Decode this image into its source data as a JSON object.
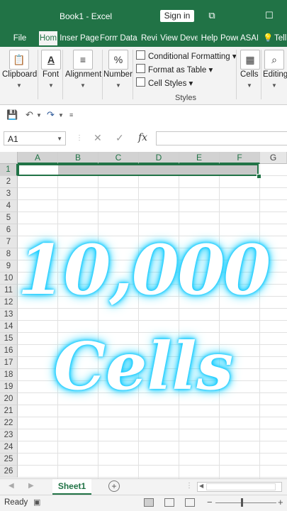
{
  "window": {
    "title": "Book1  -  Excel",
    "signin_label": "Sign in",
    "restore_icon": "⧉",
    "maximize_icon": "☐"
  },
  "tabs": [
    "File",
    "Hom",
    "Inser",
    "Page",
    "Form",
    "Data",
    "Revi",
    "View",
    "Deve",
    "Help",
    "Powe",
    "ASAI",
    "Tell"
  ],
  "tell_icon": "💡",
  "ribbon": {
    "clipboard": "Clipboard",
    "font": "Font",
    "alignment": "Alignment",
    "number": "Number",
    "conditional_formatting": "Conditional Formatting",
    "format_as_table": "Format as Table",
    "cell_styles": "Cell Styles",
    "styles_group": "Styles",
    "cells": "Cells",
    "editing": "Editing"
  },
  "formula_bar": {
    "name_box": "A1",
    "fx": "fx",
    "formula": ""
  },
  "columns": [
    "A",
    "B",
    "C",
    "D",
    "E",
    "F",
    "G"
  ],
  "rows": [
    "1",
    "2",
    "3",
    "4",
    "5",
    "6",
    "7",
    "8",
    "9",
    "10",
    "11",
    "12",
    "13",
    "14",
    "15",
    "16",
    "17",
    "18",
    "19",
    "20",
    "21",
    "22",
    "23",
    "24",
    "25",
    "26"
  ],
  "overlay": {
    "line1": "10,000",
    "line2": "Cells"
  },
  "sheet": {
    "tab": "Sheet1",
    "add_icon": "+"
  },
  "status": {
    "text": "Ready",
    "zoom_minus": "−",
    "zoom_plus": "+"
  },
  "colors": {
    "accent": "#217346",
    "glow": "#14c9ff"
  }
}
